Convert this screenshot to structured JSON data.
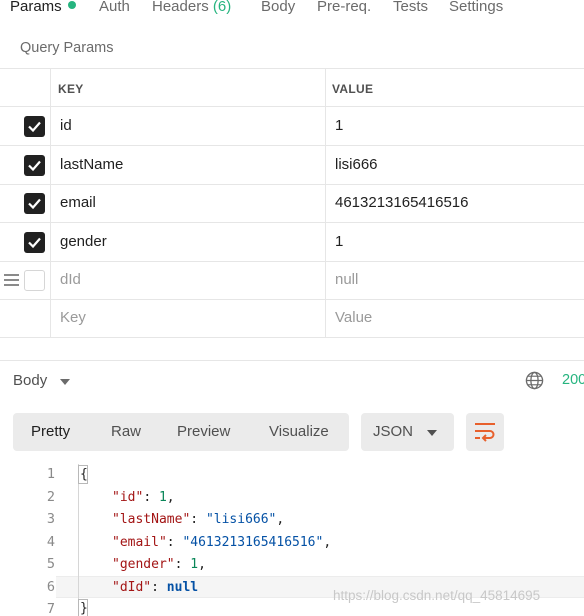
{
  "tabs": [
    {
      "label": "Params"
    },
    {
      "label": "Auth"
    },
    {
      "label": "Headers",
      "count": "(6)"
    },
    {
      "label": "Body"
    },
    {
      "label": "Pre-req."
    },
    {
      "label": "Tests"
    },
    {
      "label": "Settings"
    }
  ],
  "query_params": {
    "title": "Query Params",
    "headers": {
      "key": "KEY",
      "value": "VALUE"
    },
    "rows": [
      {
        "key": "id",
        "value": "1",
        "checked": true
      },
      {
        "key": "lastName",
        "value": "lisi666",
        "checked": true
      },
      {
        "key": "email",
        "value": "4613213165416516",
        "checked": true
      },
      {
        "key": "gender",
        "value": "1",
        "checked": true
      },
      {
        "key": "dId",
        "value": "null",
        "checked": false
      }
    ],
    "new_row": {
      "key_placeholder": "Key",
      "value_placeholder": "Value"
    }
  },
  "response": {
    "body_label": "Body",
    "status": "200",
    "views": [
      "Pretty",
      "Raw",
      "Preview",
      "Visualize"
    ],
    "format": "JSON",
    "line_numbers": [
      "1",
      "2",
      "3",
      "4",
      "5",
      "6",
      "7"
    ],
    "code": {
      "open": "{",
      "id_key": "\"id\"",
      "id_val": "1",
      "lastName_key": "\"lastName\"",
      "lastName_val": "\"lisi666\"",
      "email_key": "\"email\"",
      "email_val": "\"4613213165416516\"",
      "gender_key": "\"gender\"",
      "gender_val": "1",
      "dId_key": "\"dId\"",
      "dId_val": "null",
      "close": "}"
    }
  },
  "watermark": "https://blog.csdn.net/qq_45814695",
  "colors": {
    "accent_green": "#26b47f",
    "checkbox": "#212121",
    "wrap_icon": "#e8602c"
  }
}
